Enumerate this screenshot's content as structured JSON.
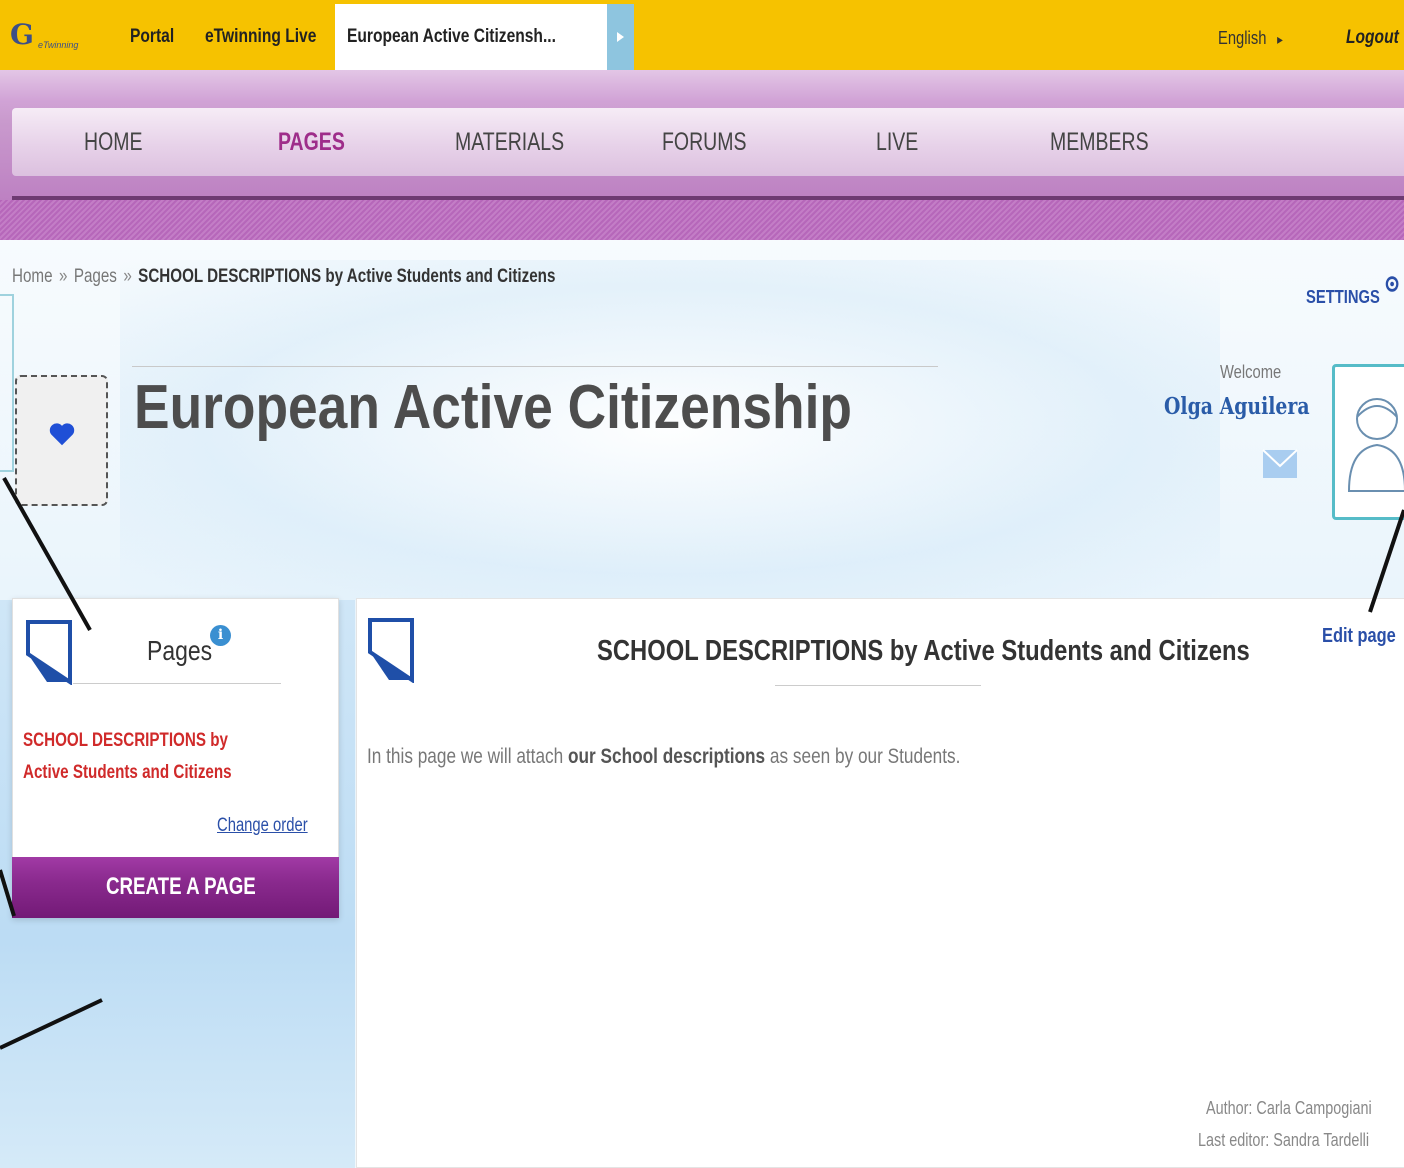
{
  "topbar": {
    "logo_text": "eTwinning",
    "links": [
      "Portal",
      "eTwinning Live"
    ],
    "active_tab": "European Active Citizensh...",
    "language": "English",
    "language_arrow": "▸",
    "logout": "Logout",
    "background": "#f6c200"
  },
  "nav": {
    "items": [
      "HOME",
      "PAGES",
      "MATERIALS",
      "FORUMS",
      "LIVE",
      "MEMBERS"
    ],
    "active": "PAGES",
    "accent": "#9e2d8a"
  },
  "breadcrumb": {
    "home": "Home",
    "separator": "»",
    "pages": "Pages",
    "current": "SCHOOL DESCRIPTIONS by Active Students and Citizens"
  },
  "settings": {
    "label": "SETTINGS",
    "icon": "gear-icon"
  },
  "project": {
    "title": "European Active Citizenship",
    "icon": "heart-icon"
  },
  "user": {
    "welcome": "Welcome",
    "name": "Olga Aguilera",
    "mail_icon": "envelope-icon",
    "avatar_icon": "user-avatar-icon"
  },
  "sidebar": {
    "title": "Pages",
    "info_icon": "info-icon",
    "info_glyph": "i",
    "page_link": "SCHOOL DESCRIPTIONS by Active Students and Citizens",
    "change_order": "Change order",
    "create_button": "CREATE A PAGE"
  },
  "main": {
    "title": "SCHOOL DESCRIPTIONS by Active Students and Citizens",
    "desc_before": "In this page we will  attach ",
    "desc_bold": "our School descriptions",
    "desc_after": " as seen by our Students.",
    "edit_page": "Edit page",
    "author": "Author: Carla Campogiani",
    "last_editor": "Last editor: Sandra Tardelli"
  }
}
